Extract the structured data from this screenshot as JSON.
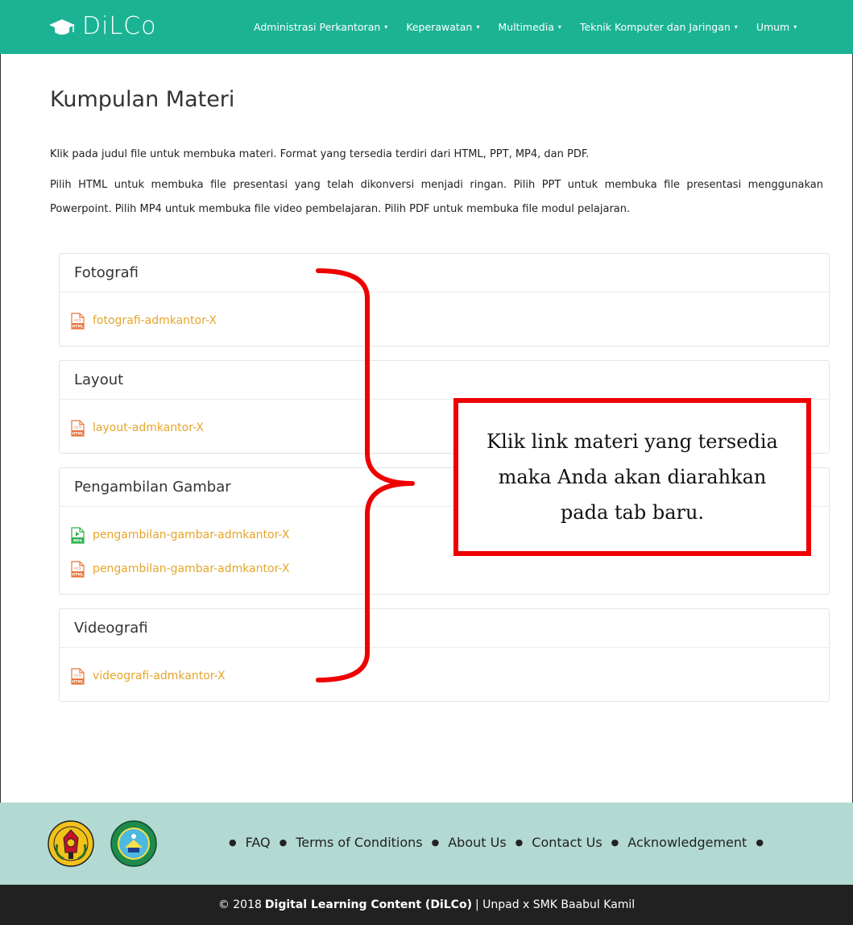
{
  "nav": {
    "brand": "DiLCo",
    "items": [
      {
        "label": "Administrasi Perkantoran"
      },
      {
        "label": "Keperawatan"
      },
      {
        "label": "Multimedia"
      },
      {
        "label": "Teknik Komputer dan Jaringan"
      },
      {
        "label": "Umum"
      }
    ],
    "caret": "▾"
  },
  "page": {
    "title": "Kumpulan Materi",
    "intro1": "Klik pada judul file untuk membuka materi. Format yang tersedia terdiri dari HTML, PPT, MP4, dan PDF.",
    "intro2": "Pilih HTML untuk membuka file presentasi yang telah dikonversi menjadi ringan. Pilih PPT untuk membuka file presentasi menggunakan Powerpoint. Pilih MP4 untuk membuka file video pembelajaran. Pilih PDF untuk membuka file modul pelajaran."
  },
  "panels": [
    {
      "title": "Fotografi",
      "files": [
        {
          "label": "fotografi-admkantor-X",
          "type": "HTML"
        }
      ]
    },
    {
      "title": "Layout",
      "files": [
        {
          "label": "layout-admkantor-X",
          "type": "HTML"
        }
      ]
    },
    {
      "title": "Pengambilan Gambar",
      "files": [
        {
          "label": "pengambilan-gambar-admkantor-X",
          "type": "MP4"
        },
        {
          "label": "pengambilan-gambar-admkantor-X",
          "type": "HTML"
        }
      ]
    },
    {
      "title": "Videografi",
      "files": [
        {
          "label": "videografi-admkantor-X",
          "type": "HTML"
        }
      ]
    }
  ],
  "annotation": {
    "line1": "Klik link materi yang tersedia",
    "line2": "maka Anda akan diarahkan",
    "line3": "pada tab baru."
  },
  "footer": {
    "links": [
      "FAQ",
      "Terms of Conditions",
      "About Us",
      "Contact Us",
      "Acknowledgement"
    ],
    "bullet": "●",
    "copyright_prefix": "© 2018",
    "copyright_name": "Digital Learning Content (DiLCo)",
    "copyright_suffix": "| Unpad x SMK Baabul Kamil"
  },
  "colors": {
    "nav_bg": "#1bb394",
    "link": "#e6a52b",
    "html_icon": "#e8743b",
    "mp4_icon": "#2bb24c",
    "annotation": "#ee0000",
    "footer_bg": "#b3d9d3",
    "copyright_bg": "#212121"
  },
  "icons": {
    "brand": "graduation-cap-icon",
    "html_file": "html-file-icon",
    "mp4_file": "mp4-file-icon"
  }
}
